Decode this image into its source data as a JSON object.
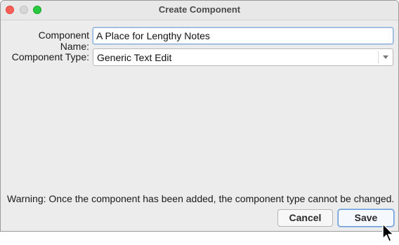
{
  "window": {
    "title": "Create Component"
  },
  "form": {
    "name_label": "Component Name:",
    "name_value": "A Place for Lengthy Notes",
    "type_label": "Component Type:",
    "type_value": "Generic Text Edit"
  },
  "warning_text": "Warning: Once the component has been added, the component type cannot be changed.",
  "buttons": {
    "cancel_label": "Cancel",
    "save_label": "Save"
  },
  "colors": {
    "close": "#fe5f57",
    "minimize_inactive": "#d6d6d6",
    "maximize": "#28c840",
    "focus_ring": "#9fc0e8"
  },
  "icons": {
    "dropdown": "chevron-down-icon",
    "pointer": "mouse-pointer-icon"
  }
}
